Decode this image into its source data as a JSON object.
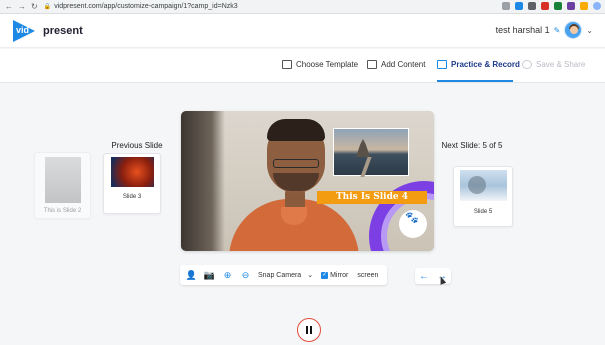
{
  "browser": {
    "url": "vidpresent.com/app/customize-campaign/1?camp_id=Nzk3"
  },
  "header": {
    "logo_word_a": "vid",
    "logo_word_b": "present",
    "user_name": "test harshal 1"
  },
  "steps": [
    {
      "label": "Choose Template",
      "state": "done"
    },
    {
      "label": "Add Content",
      "state": "done"
    },
    {
      "label": "Practice & Record",
      "state": "active"
    },
    {
      "label": "Save & Share",
      "state": "disabled"
    }
  ],
  "stage": {
    "previous_label": "Previous Slide",
    "next_label": "Next Slide: 5 of 5",
    "slide2_caption": "This is Slide 2",
    "slide3_caption": "Slide 3",
    "slide5_caption": "Slide 5",
    "current_banner": "This Is Slide 4"
  },
  "controls": {
    "camera_source": "Snap Camera",
    "mirror_label": "Mirror",
    "mirror_checked": true,
    "screen_label": "screen"
  },
  "colors": {
    "accent": "#1e88e5",
    "banner": "#f39c12",
    "brand_purple": "#7b3fe4",
    "record_ring": "#e04b3c"
  }
}
